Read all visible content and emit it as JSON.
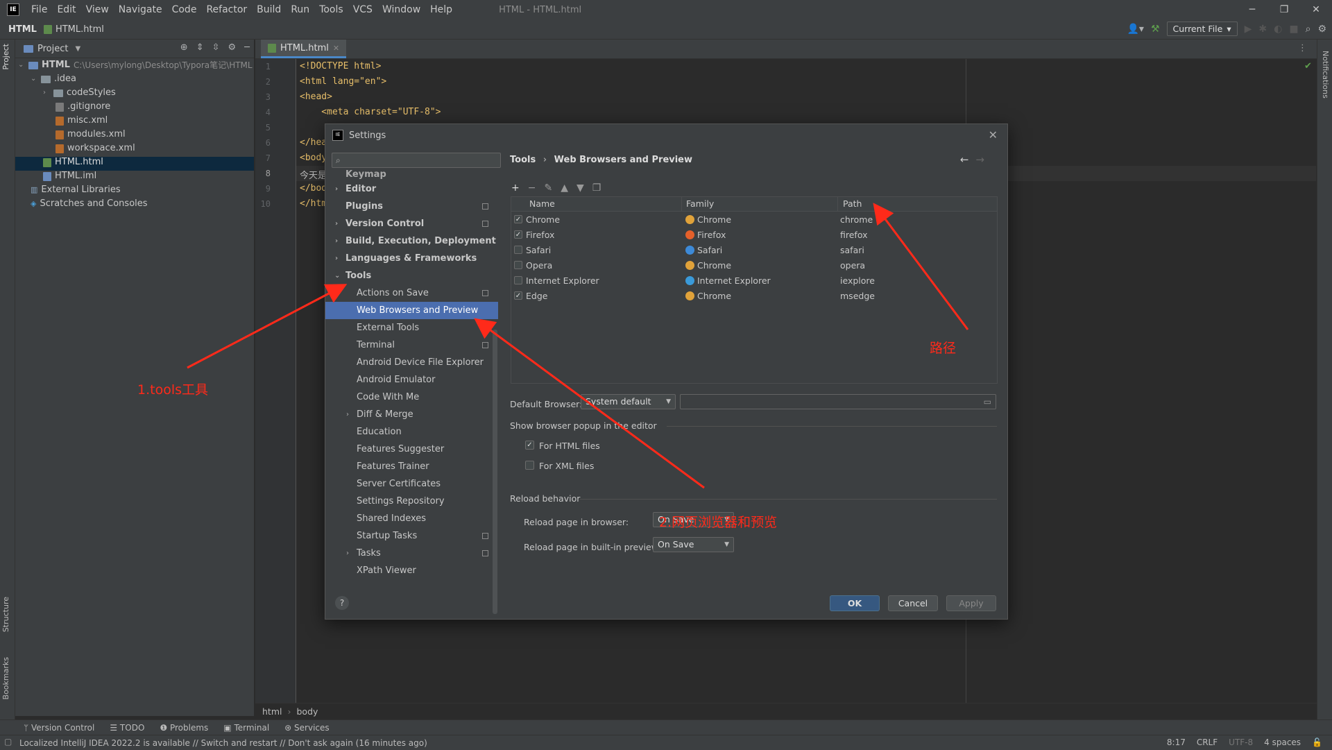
{
  "menubar": {
    "logo": "IE",
    "items": [
      "File",
      "Edit",
      "View",
      "Navigate",
      "Code",
      "Refactor",
      "Build",
      "Run",
      "Tools",
      "VCS",
      "Window",
      "Help"
    ],
    "window_title": "HTML - HTML.html"
  },
  "navbar": {
    "project": "HTML",
    "file": "HTML.html",
    "run_config": "Current File"
  },
  "left_strip": {
    "project": "Project",
    "structure": "Structure",
    "bookmarks": "Bookmarks"
  },
  "right_strip": {
    "notifications": "Notifications"
  },
  "project_pane": {
    "title": "Project",
    "tree": [
      {
        "label": "HTML",
        "extra": "C:\\Users\\mylong\\Desktop\\Typora笔记\\HTML"
      },
      {
        "label": ".idea"
      },
      {
        "label": "codeStyles"
      },
      {
        "label": ".gitignore"
      },
      {
        "label": "misc.xml"
      },
      {
        "label": "modules.xml"
      },
      {
        "label": "workspace.xml"
      },
      {
        "label": "HTML.html"
      },
      {
        "label": "HTML.iml"
      },
      {
        "label": "External Libraries"
      },
      {
        "label": "Scratches and Consoles"
      }
    ]
  },
  "editor": {
    "tab": "HTML.html",
    "line_numbers": [
      "1",
      "2",
      "3",
      "4",
      "5",
      "6",
      "7",
      "8",
      "9",
      "10"
    ],
    "lines": [
      "<!DOCTYPE html>",
      "<html lang=\"en\">",
      "<head>",
      "    <meta charset=\"UTF-8\">",
      "",
      "</hea",
      "<body",
      "今天是",
      "</bod",
      "</htm"
    ],
    "breadcrumb": [
      "html",
      "body"
    ]
  },
  "bottom_tools": [
    "Version Control",
    "TODO",
    "Problems",
    "Terminal",
    "Services"
  ],
  "status": {
    "message": "Localized IntelliJ IDEA 2022.2 is available // Switch and restart // Don't ask again (16 minutes ago)",
    "position": "8:17",
    "line_sep": "CRLF",
    "encoding": "UTF-8",
    "indent": "4 spaces"
  },
  "dialog": {
    "title": "Settings",
    "search_placeholder": "",
    "tree": [
      {
        "label": "Keymap"
      },
      {
        "label": "Editor"
      },
      {
        "label": "Plugins"
      },
      {
        "label": "Version Control"
      },
      {
        "label": "Build, Execution, Deployment"
      },
      {
        "label": "Languages & Frameworks"
      },
      {
        "label": "Tools"
      },
      {
        "label": "Actions on Save"
      },
      {
        "label": "Web Browsers and Preview"
      },
      {
        "label": "External Tools"
      },
      {
        "label": "Terminal"
      },
      {
        "label": "Android Device File Explorer"
      },
      {
        "label": "Android Emulator"
      },
      {
        "label": "Code With Me"
      },
      {
        "label": "Diff & Merge"
      },
      {
        "label": "Education"
      },
      {
        "label": "Features Suggester"
      },
      {
        "label": "Features Trainer"
      },
      {
        "label": "Server Certificates"
      },
      {
        "label": "Settings Repository"
      },
      {
        "label": "Shared Indexes"
      },
      {
        "label": "Startup Tasks"
      },
      {
        "label": "Tasks"
      },
      {
        "label": "XPath Viewer"
      }
    ],
    "crumb_parent": "Tools",
    "crumb_sep": "›",
    "crumb_current": "Web Browsers and Preview",
    "table": {
      "headers": [
        "Name",
        "Family",
        "Path"
      ],
      "rows": [
        {
          "checked": true,
          "name": "Chrome",
          "family": "Chrome",
          "path": "chrome",
          "icon_color": "#e0a23a"
        },
        {
          "checked": true,
          "name": "Firefox",
          "family": "Firefox",
          "path": "firefox",
          "icon_color": "#e5602a"
        },
        {
          "checked": false,
          "name": "Safari",
          "family": "Safari",
          "path": "safari",
          "icon_color": "#3d8ad8"
        },
        {
          "checked": false,
          "name": "Opera",
          "family": "Chrome",
          "path": "opera",
          "icon_color": "#e0a23a"
        },
        {
          "checked": false,
          "name": "Internet Explorer",
          "family": "Internet Explorer",
          "path": "iexplore",
          "icon_color": "#3a9ad9"
        },
        {
          "checked": true,
          "name": "Edge",
          "family": "Chrome",
          "path": "msedge",
          "icon_color": "#e0a23a"
        }
      ]
    },
    "default_browser_label": "Default Browser:",
    "default_browser_value": "System default",
    "popup_label": "Show browser popup in the editor",
    "for_html": {
      "label": "For HTML files",
      "checked": true
    },
    "for_xml": {
      "label": "For XML files",
      "checked": false
    },
    "reload_label": "Reload behavior",
    "reload_browser_label": "Reload page in browser:",
    "reload_browser_value": "On Save",
    "reload_preview_label": "Reload page in built-in preview:",
    "reload_preview_value": "On Save",
    "ok": "OK",
    "cancel": "Cancel",
    "apply": "Apply",
    "help": "?"
  },
  "annotations": {
    "tools": "1.tools工具",
    "web": "2.网页浏览器和预览",
    "path": "路径",
    "color": "#ff2a1a"
  }
}
